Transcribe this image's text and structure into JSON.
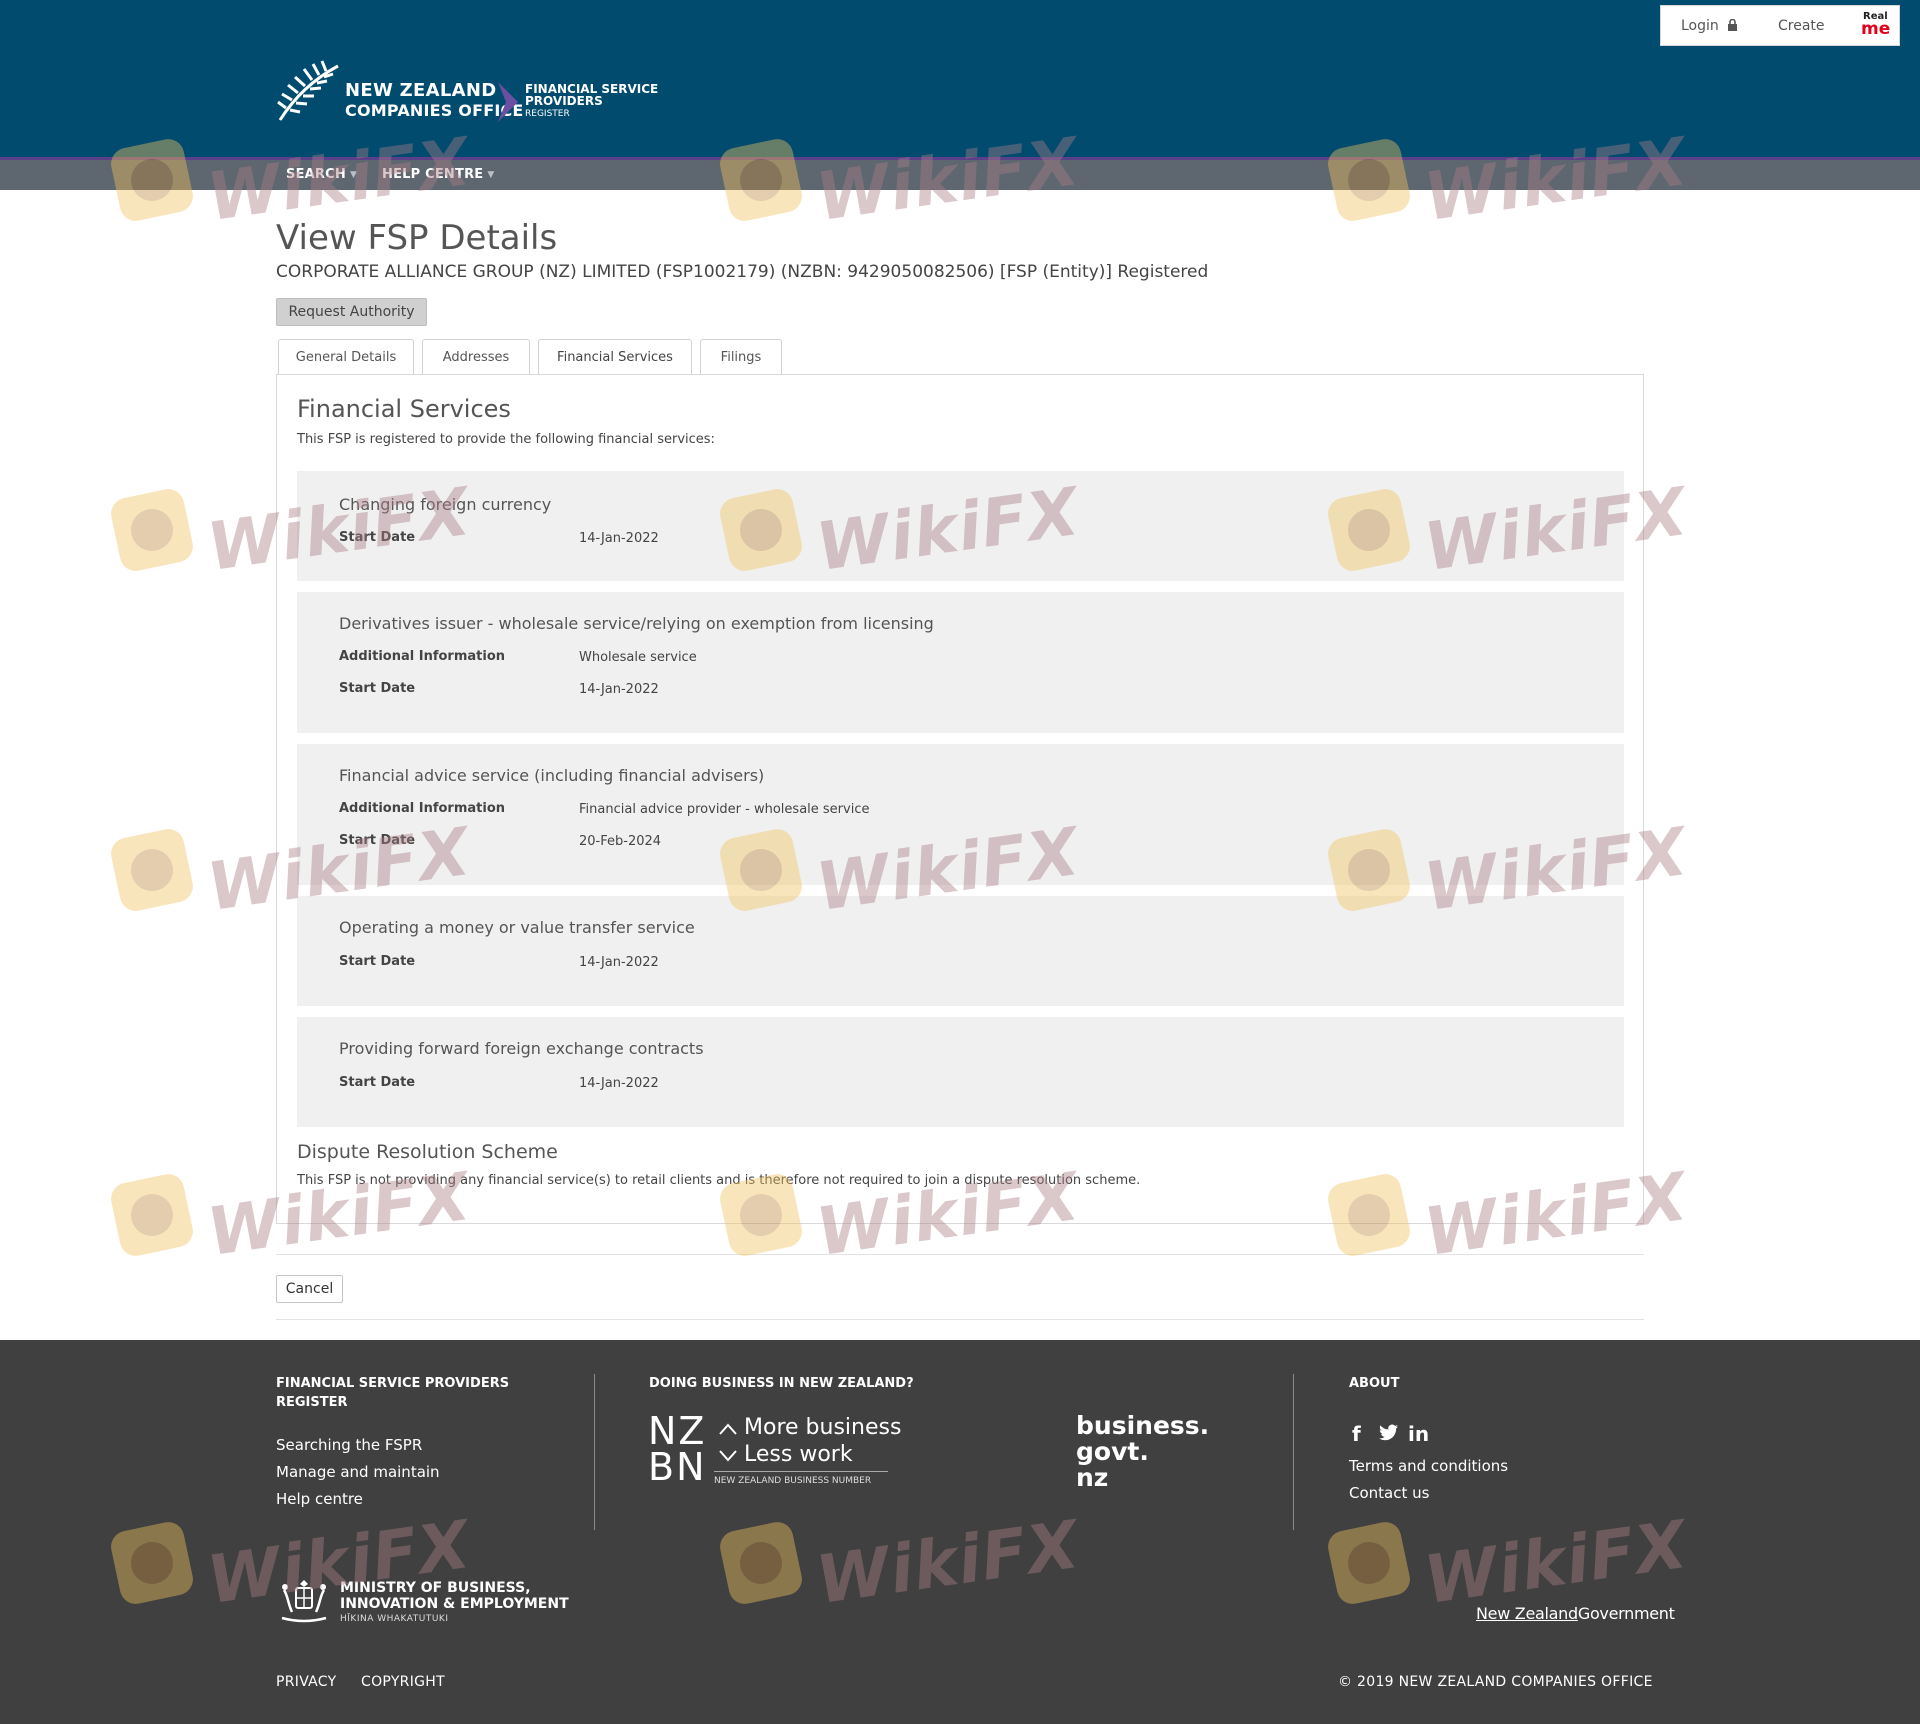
{
  "header": {
    "logo_line1": "NEW ZEALAND",
    "logo_line2": "COMPANIES OFFICE",
    "fsp_line1": "FINANCIAL SERVICE",
    "fsp_line2": "PROVIDERS",
    "fsp_line3": "REGISTER",
    "login": "Login",
    "create": "Create",
    "realme_top": "Real",
    "realme_bottom": "me",
    "nav": [
      {
        "label": "SEARCH"
      },
      {
        "label": "HELP CENTRE"
      }
    ]
  },
  "main": {
    "title": "View FSP Details",
    "entity": "CORPORATE ALLIANCE GROUP (NZ) LIMITED (FSP1002179) (NZBN: 9429050082506) [FSP (Entity)] Registered",
    "request_authority": "Request Authority",
    "tabs": [
      {
        "label": "General Details"
      },
      {
        "label": "Addresses"
      },
      {
        "label": "Financial Services",
        "active": true
      },
      {
        "label": "Filings"
      }
    ],
    "panel_title": "Financial Services",
    "intro": "This FSP is registered to provide the following financial services:",
    "services": [
      {
        "name": "Changing foreign currency",
        "start_label": "Start Date",
        "start_date": "14-Jan-2022"
      },
      {
        "name": "Derivatives issuer - wholesale service/relying on exemption from licensing",
        "info_label": "Additional Information",
        "info": "Wholesale service",
        "start_label": "Start Date",
        "start_date": "14-Jan-2022"
      },
      {
        "name": "Financial advice service (including financial advisers)",
        "info_label": "Additional Information",
        "info": "Financial advice provider - wholesale service",
        "start_label": "Start Date",
        "start_date": "20-Feb-2024"
      },
      {
        "name": "Operating a money or value transfer service",
        "start_label": "Start Date",
        "start_date": "14-Jan-2022"
      },
      {
        "name": "Providing forward foreign exchange contracts",
        "start_label": "Start Date",
        "start_date": "14-Jan-2022"
      }
    ],
    "drs_title": "Dispute Resolution Scheme",
    "drs_text": "This FSP is not providing any financial service(s) to retail clients and is therefore not required to join a dispute resolution scheme.",
    "cancel": "Cancel"
  },
  "footer": {
    "fspr_heading_1": "FINANCIAL SERVICE PROVIDERS",
    "fspr_heading_2": "REGISTER",
    "fspr_links": [
      "Searching the FSPR",
      "Manage and maintain",
      "Help centre"
    ],
    "doing_business": "DOING BUSINESS IN NEW ZEALAND?",
    "nzbn_letters_1": "NZ",
    "nzbn_letters_2": "BN",
    "nzbn_more": "More business",
    "nzbn_less": "Less work",
    "nzbn_sub": "NEW ZEALAND BUSINESS NUMBER",
    "bgn_1": "business.",
    "bgn_2": "govt.",
    "bgn_3": "nz",
    "about": "ABOUT",
    "social": [
      "f",
      "t",
      "in"
    ],
    "about_links": [
      "Terms and conditions",
      "Contact us"
    ],
    "mbie_1": "MINISTRY OF BUSINESS,",
    "mbie_2": "INNOVATION & EMPLOYMENT",
    "mbie_3": "HĪKINA WHAKATUTUKI",
    "nzgovt_1": "New Zealand",
    "nzgovt_2": "Government",
    "privacy": "PRIVACY",
    "copyright_link": "COPYRIGHT",
    "copyright": "© 2019 NEW ZEALAND COMPANIES OFFICE"
  },
  "watermark": "WikiFX",
  "colors": {
    "header_bg": "#004b6e",
    "nav_bg": "#5e6770",
    "accent_purple": "#5a3f8a",
    "footer_bg": "#404040",
    "service_bg": "#f0f0f0"
  }
}
